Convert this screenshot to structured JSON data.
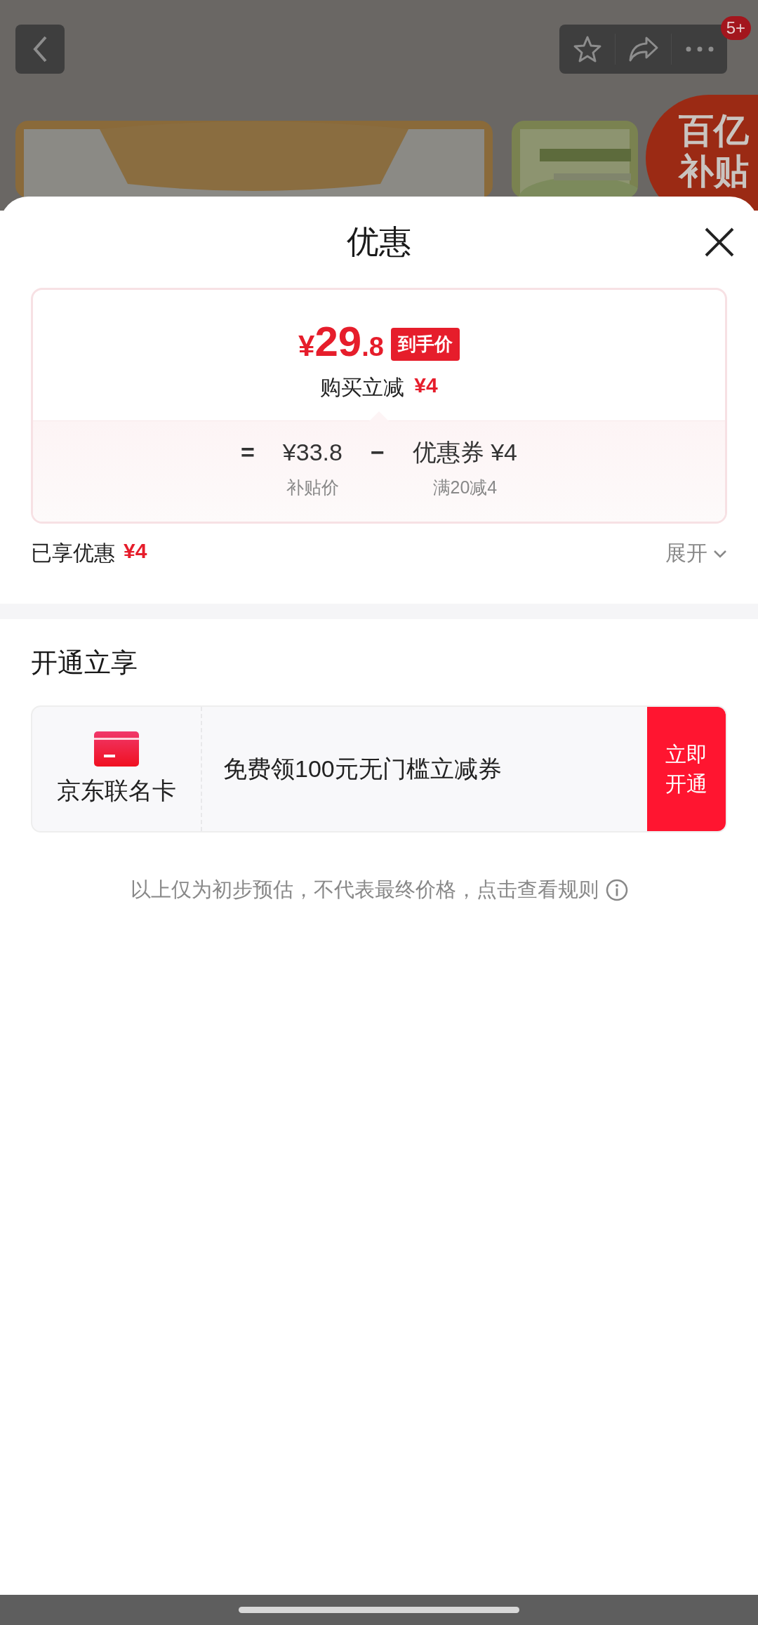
{
  "background": {
    "cart_badge": "5+",
    "promo_badge": "百亿补贴"
  },
  "sheet": {
    "title": "优惠",
    "price": {
      "currency": "¥",
      "integer": "29",
      "decimal": ".8",
      "tag": "到手价"
    },
    "instant_discount": {
      "label": "购买立减",
      "amount": "¥4"
    },
    "breakdown": {
      "equals": "=",
      "minus": "−",
      "items": [
        {
          "value": "¥33.8",
          "caption": "补贴价"
        },
        {
          "value": "优惠券 ¥4",
          "caption": "满20减4"
        }
      ]
    },
    "enjoyed": {
      "label": "已享优惠",
      "amount": "¥4",
      "expand": "展开",
      "expanded": false
    },
    "section_title": "开通立享",
    "offer": {
      "card_name": "京东联名卡",
      "description": "免费领100元无门槛立减券",
      "button": "立即开通"
    },
    "disclaimer": "以上仅为初步预估，不代表最终价格，点击查看规则"
  }
}
